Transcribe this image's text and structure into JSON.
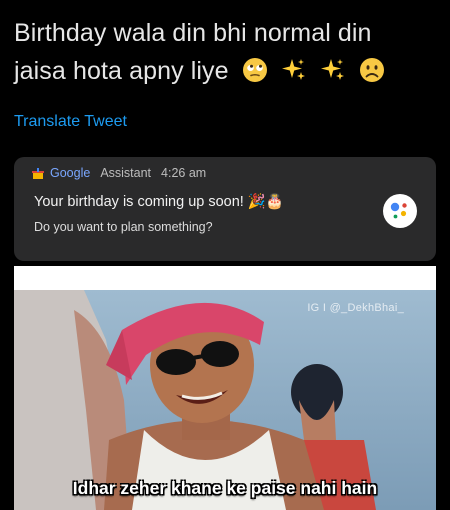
{
  "tweet": {
    "line1": "Birthday wala din bhi normal din",
    "line2": "jaisa hota apny liye",
    "emojis": [
      "rolling-eyes-emoji",
      "sparkles-emoji",
      "sparkles-emoji",
      "frowning-face-emoji"
    ],
    "translate_label": "Translate Tweet"
  },
  "notification": {
    "app_name": "Google",
    "source": "Assistant",
    "time": "4:26 am",
    "title": "Your birthday is coming up soon! 🎉🎂",
    "subtitle": "Do you want to plan something?",
    "icon": "google-assistant-icon"
  },
  "meme": {
    "watermark": "IG I @_DekhBhai_",
    "caption": "Idhar zeher khane ke paise nahi hain"
  },
  "colors": {
    "background": "#000000",
    "link": "#1d9bf0",
    "card": "#2a2a2b"
  }
}
